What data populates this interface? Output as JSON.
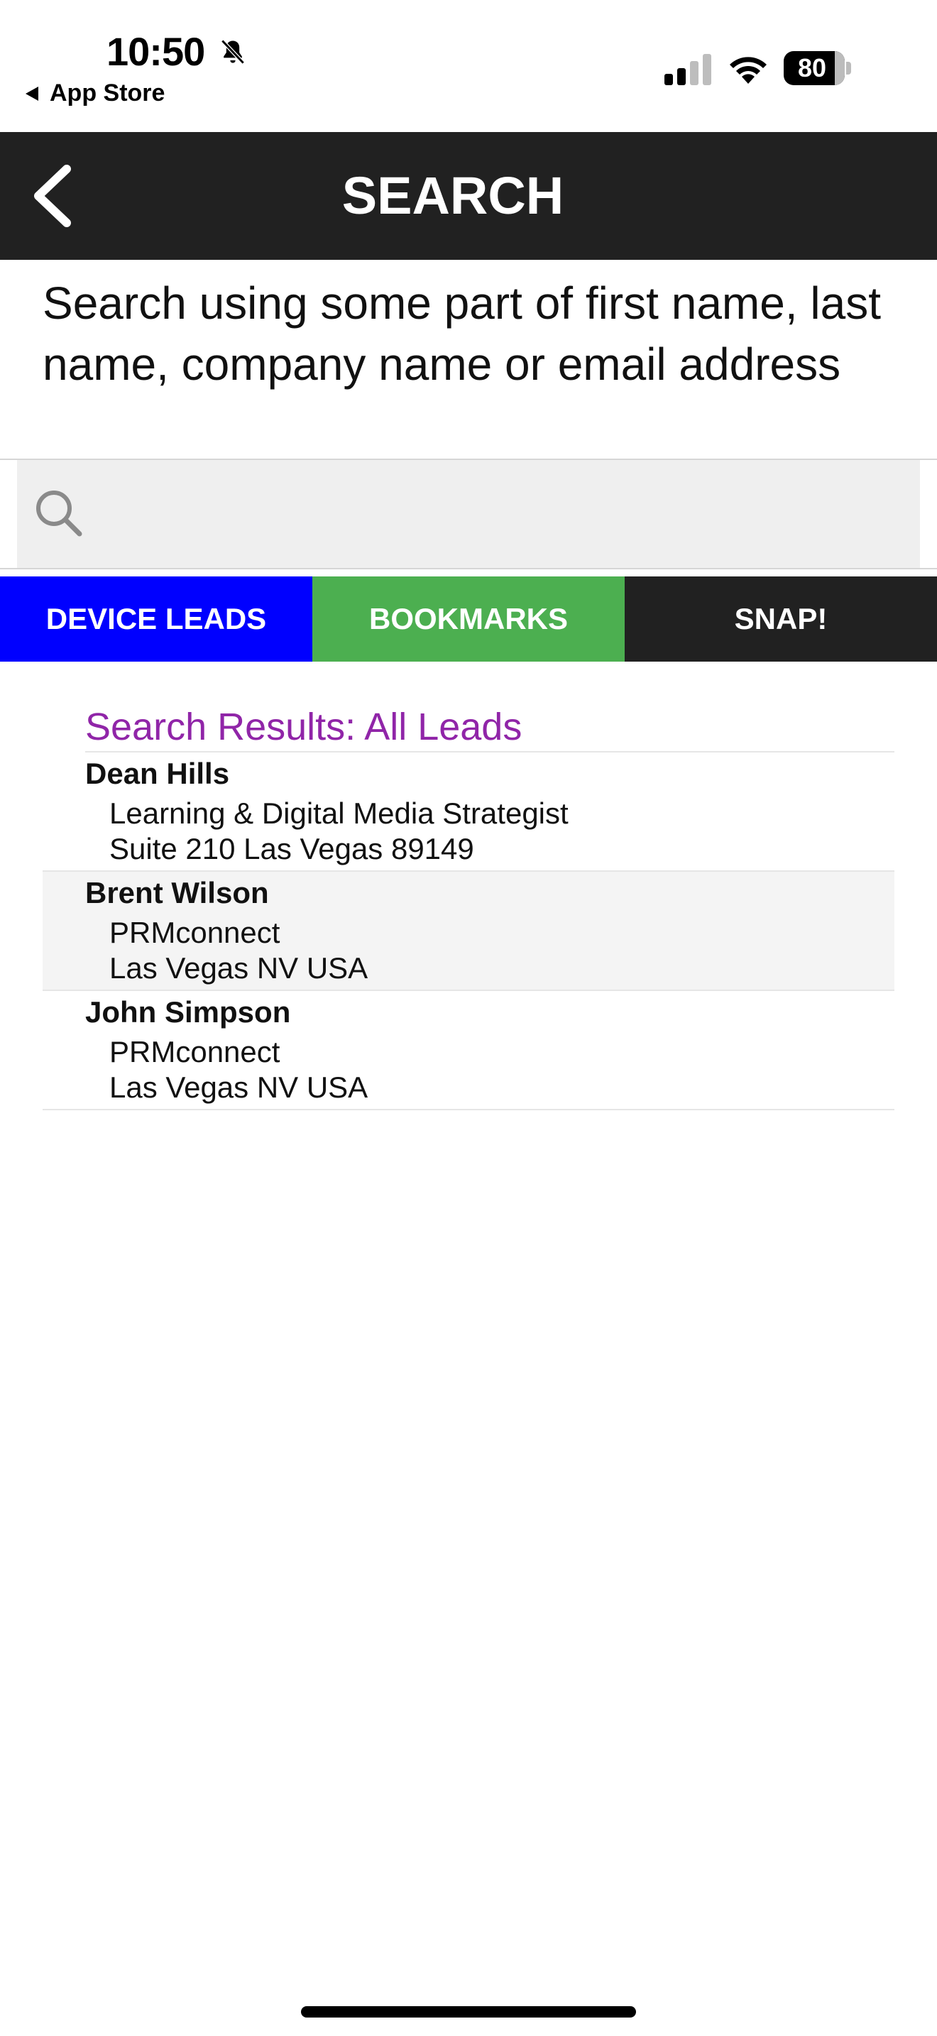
{
  "status_bar": {
    "time": "10:50",
    "back_label": "App Store",
    "battery": "80"
  },
  "nav": {
    "title": "SEARCH"
  },
  "instructions": "Search using some part of first name, last name, company name or email address",
  "search": {
    "value": "",
    "placeholder": ""
  },
  "tabs": [
    {
      "label": "DEVICE LEADS",
      "color": "#0000ff"
    },
    {
      "label": "BOOKMARKS",
      "color": "#4caf50"
    },
    {
      "label": "SNAP!",
      "color": "#212121"
    }
  ],
  "results": {
    "heading": "Search Results: All Leads",
    "items": [
      {
        "name": "Dean Hills",
        "line1": "Learning & Digital Media Strategist",
        "line2": "Suite 210 Las Vegas 89149"
      },
      {
        "name": "Brent Wilson",
        "line1": "PRMconnect",
        "line2": "Las Vegas NV USA"
      },
      {
        "name": "John Simpson",
        "line1": "PRMconnect",
        "line2": "Las Vegas NV USA"
      }
    ]
  },
  "colors": {
    "heading_purple": "#9025a8",
    "nav_background": "#212121"
  }
}
